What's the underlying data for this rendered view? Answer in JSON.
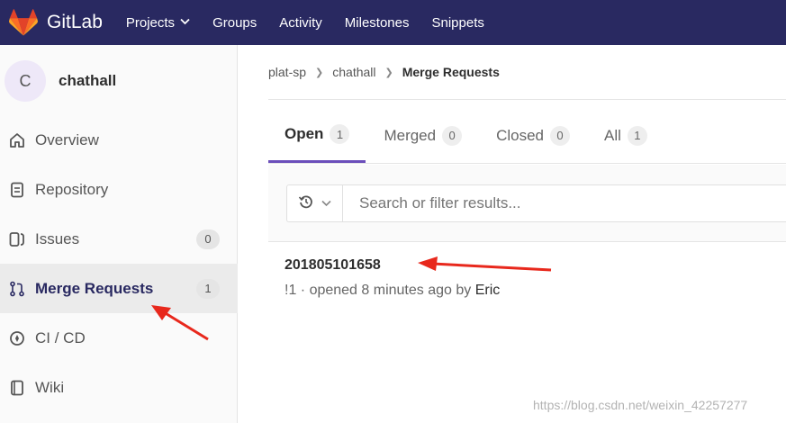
{
  "topbar": {
    "logo_text": "GitLab",
    "nav": [
      {
        "label": "Projects",
        "dropdown": true
      },
      {
        "label": "Groups"
      },
      {
        "label": "Activity"
      },
      {
        "label": "Milestones"
      },
      {
        "label": "Snippets"
      }
    ],
    "bg_color": "#292961"
  },
  "sidebar": {
    "avatar_letter": "C",
    "project_name": "chathall",
    "items": [
      {
        "label": "Overview",
        "icon": "home-icon"
      },
      {
        "label": "Repository",
        "icon": "doc-icon"
      },
      {
        "label": "Issues",
        "icon": "issues-icon",
        "count": "0"
      },
      {
        "label": "Merge Requests",
        "icon": "merge-request-icon",
        "count": "1",
        "active": true
      },
      {
        "label": "CI / CD",
        "icon": "rocket-icon"
      },
      {
        "label": "Wiki",
        "icon": "book-icon"
      }
    ]
  },
  "breadcrumb": [
    "plat-sp",
    "chathall",
    "Merge Requests"
  ],
  "tabs": [
    {
      "label": "Open",
      "count": "1",
      "active": true
    },
    {
      "label": "Merged",
      "count": "0"
    },
    {
      "label": "Closed",
      "count": "0"
    },
    {
      "label": "All",
      "count": "1"
    }
  ],
  "search": {
    "placeholder": "Search or filter results..."
  },
  "merge_request": {
    "title": "201805101658",
    "meta_prefix": "!1 · opened 8 minutes ago by ",
    "author": "Eric"
  },
  "watermark": "https://blog.csdn.net/weixin_42257277",
  "accent_color": "#6b4fbb",
  "annotation_color": "#e8281c"
}
